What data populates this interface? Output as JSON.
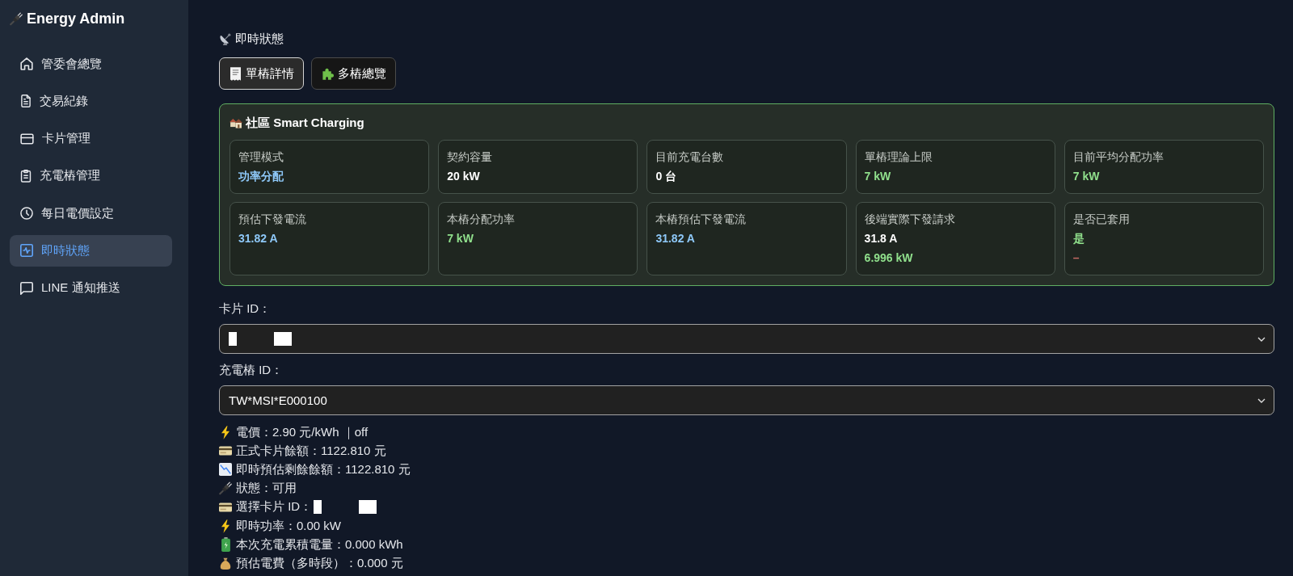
{
  "sidebar": {
    "title": "Energy Admin",
    "items": [
      {
        "label": "管委會總覽",
        "selected": false
      },
      {
        "label": "交易紀錄",
        "selected": false
      },
      {
        "label": "卡片管理",
        "selected": false
      },
      {
        "label": "充電樁管理",
        "selected": false
      },
      {
        "label": "每日電價設定",
        "selected": false
      },
      {
        "label": "即時狀態",
        "selected": true
      },
      {
        "label": "LINE 通知推送",
        "selected": false
      }
    ]
  },
  "page": {
    "heading": "即時狀態"
  },
  "tabs": [
    {
      "label": "單樁詳情",
      "selected": true
    },
    {
      "label": "多樁總覽",
      "selected": false
    }
  ],
  "smart_charging": {
    "title": "社區 Smart Charging",
    "stats": [
      {
        "label": "管理模式",
        "values": [
          {
            "text": "功率分配",
            "color": "#8ec8f8"
          }
        ]
      },
      {
        "label": "契約容量",
        "values": [
          {
            "text": "20 kW",
            "color": "#ffffff"
          }
        ]
      },
      {
        "label": "目前充電台數",
        "values": [
          {
            "text": "0 台",
            "color": "#ffffff"
          }
        ]
      },
      {
        "label": "單樁理論上限",
        "values": [
          {
            "text": "7 kW",
            "color": "#90e08c"
          }
        ]
      },
      {
        "label": "目前平均分配功率",
        "values": [
          {
            "text": "7 kW",
            "color": "#90e08c"
          }
        ]
      },
      {
        "label": "預估下發電流",
        "values": [
          {
            "text": "31.82 A",
            "color": "#8ec8f8"
          }
        ]
      },
      {
        "label": "本樁分配功率",
        "values": [
          {
            "text": "7 kW",
            "color": "#90e08c"
          }
        ]
      },
      {
        "label": "本樁預估下發電流",
        "values": [
          {
            "text": "31.82 A",
            "color": "#8ec8f8"
          }
        ]
      },
      {
        "label": "後端實際下發請求",
        "values": [
          {
            "text": "31.8 A",
            "color": "#ffffff"
          },
          {
            "text": "6.996 kW",
            "color": "#90e08c"
          }
        ]
      },
      {
        "label": "是否已套用",
        "values": [
          {
            "text": "是",
            "color": "#90e08c"
          },
          {
            "text": "–",
            "color": "#c46a64"
          }
        ]
      }
    ]
  },
  "fields": [
    {
      "label": "卡片 ID：",
      "redacted": true
    },
    {
      "label": "充電樁 ID：",
      "value": "TW*MSI*E000100",
      "redacted": false
    }
  ],
  "info": [
    {
      "text": "電價：2.90 元/kWh ｜off",
      "redacted": false
    },
    {
      "text": "正式卡片餘額：1122.810 元",
      "redacted": false
    },
    {
      "text": "即時預估剩餘餘額：1122.810 元",
      "redacted": false
    },
    {
      "text": "狀態：可用",
      "redacted": false
    },
    {
      "text": "選擇卡片 ID：",
      "redacted": true
    },
    {
      "text": "即時功率：0.00 kW",
      "redacted": false
    },
    {
      "text": "本次充電累積電量：0.000 kWh",
      "redacted": false
    },
    {
      "text": "預估電費（多時段）：0.000 元",
      "redacted": false
    }
  ]
}
